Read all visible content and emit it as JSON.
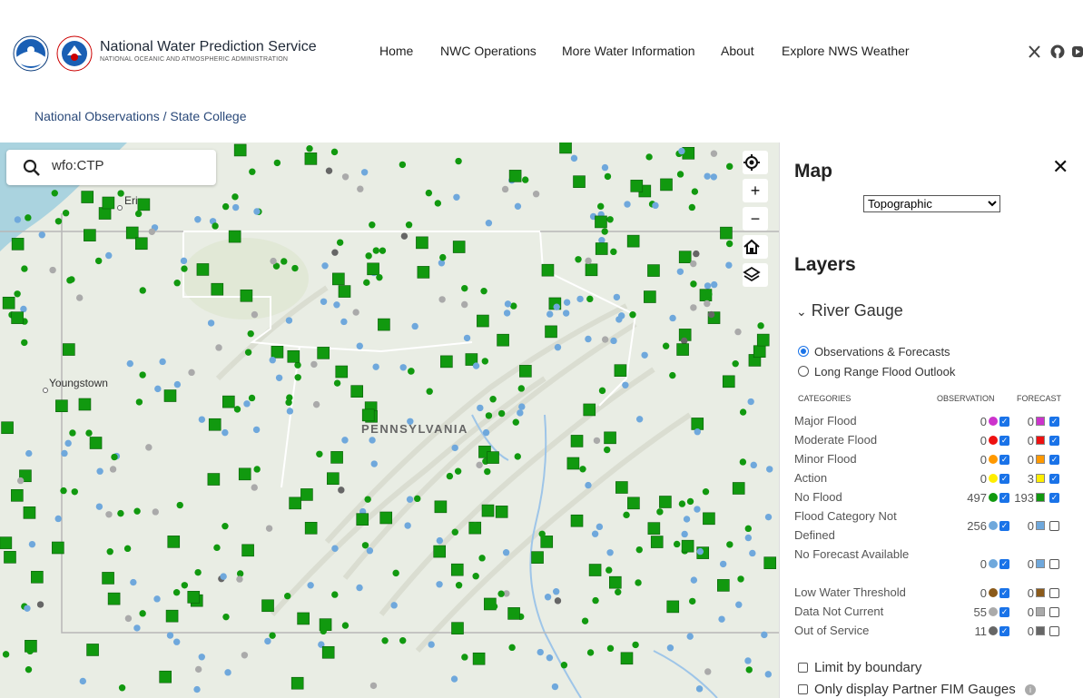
{
  "header": {
    "title": "National Water Prediction Service",
    "subtitle": "NATIONAL OCEANIC AND ATMOSPHERIC ADMINISTRATION",
    "nav": [
      "Home",
      "NWC Operations",
      "More Water Information",
      "About",
      "Explore NWS Weather"
    ],
    "social_icons": [
      "x-icon",
      "github-icon",
      "youtube-icon"
    ]
  },
  "breadcrumb": {
    "root": "National Observations",
    "separator": "/",
    "current": "State College"
  },
  "search": {
    "value": "wfo:CTP"
  },
  "map": {
    "labels": {
      "erie": "Erie",
      "youngstown": "Youngstown",
      "state": "PENNSYLVANIA"
    },
    "controls": [
      "locate-icon",
      "zoom-in-icon",
      "zoom-out-icon",
      "home-icon",
      "layers-icon"
    ],
    "colors": {
      "no_flood": "#11990f",
      "not_defined": "#6fa8dc",
      "not_current": "#aaaaaa",
      "out_of_service": "#666666",
      "water": "#aad3df"
    }
  },
  "panel": {
    "map_title": "Map",
    "basemap_selected": "Topographic",
    "layers_title": "Layers",
    "layer_group": "River Gauge",
    "radio_options": [
      {
        "label": "Observations & Forecasts",
        "selected": true
      },
      {
        "label": "Long Range Flood Outlook",
        "selected": false
      }
    ],
    "table_headers": {
      "categories": "CATEGORIES",
      "observation": "OBSERVATION",
      "forecast": "FORECAST"
    },
    "categories": [
      {
        "label": "Major Flood",
        "obs": "0",
        "obs_color": "#cc33cc",
        "obs_checked": true,
        "fc": "0",
        "fc_color": "#cc33cc",
        "fc_checked": true
      },
      {
        "label": "Moderate Flood",
        "obs": "0",
        "obs_color": "#ee1111",
        "obs_checked": true,
        "fc": "0",
        "fc_color": "#ee1111",
        "fc_checked": true
      },
      {
        "label": "Minor Flood",
        "obs": "0",
        "obs_color": "#ff9900",
        "obs_checked": true,
        "fc": "0",
        "fc_color": "#ff9900",
        "fc_checked": true
      },
      {
        "label": "Action",
        "obs": "0",
        "obs_color": "#ffee00",
        "obs_checked": true,
        "fc": "3",
        "fc_color": "#ffee00",
        "fc_checked": true
      },
      {
        "label": "No Flood",
        "obs": "497",
        "obs_color": "#11990f",
        "obs_checked": true,
        "fc": "193",
        "fc_color": "#11990f",
        "fc_checked": true
      },
      {
        "label": "Flood Category Not Defined",
        "obs": "256",
        "obs_color": "#6fa8dc",
        "obs_checked": true,
        "fc": "0",
        "fc_color": "#6fa8dc",
        "fc_checked": false
      },
      {
        "label": "No Forecast Available",
        "obs": "0",
        "obs_color": "#6fa8dc",
        "obs_checked": true,
        "fc": "0",
        "fc_color": "#6fa8dc",
        "fc_checked": false
      },
      {
        "label": "Low Water Threshold",
        "obs": "0",
        "obs_color": "#8b5a1a",
        "obs_checked": true,
        "fc": "0",
        "fc_color": "#8b5a1a",
        "fc_checked": false
      },
      {
        "label": "Data Not Current",
        "obs": "55",
        "obs_color": "#aaaaaa",
        "obs_checked": true,
        "fc": "0",
        "fc_color": "#aaaaaa",
        "fc_checked": false
      },
      {
        "label": "Out of Service",
        "obs": "11",
        "obs_color": "#666666",
        "obs_checked": true,
        "fc": "0",
        "fc_color": "#666666",
        "fc_checked": false
      }
    ],
    "limit_by_boundary": "Limit by boundary",
    "partner_fim": "Only display Partner FIM Gauges"
  }
}
